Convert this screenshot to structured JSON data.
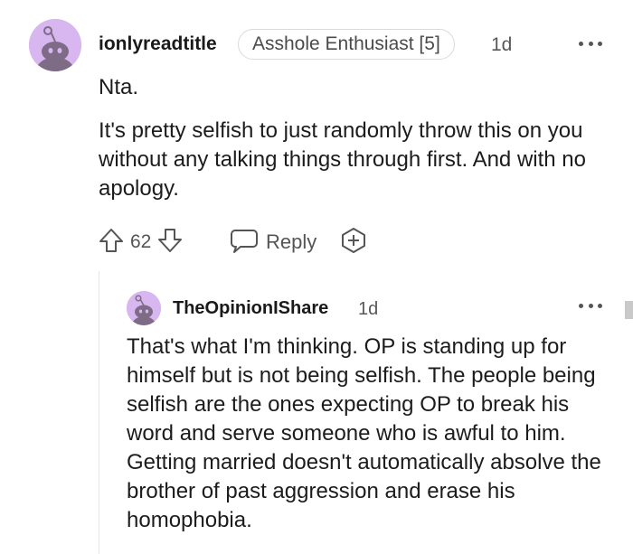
{
  "comment": {
    "username": "ionlyreadtitle",
    "flair": "Asshole Enthusiast [5]",
    "time": "1d",
    "paragraphs": [
      "Nta.",
      "It's pretty selfish to just randomly throw this on you without any talking things through first. And with no apology."
    ],
    "score": "62",
    "reply_label": "Reply",
    "colors": {
      "avatar_bg": "#d8b6f0",
      "avatar_figure": "#7e6b86"
    },
    "icons": [
      "snoo-avatar-icon",
      "upvote-icon",
      "downvote-icon",
      "reply-icon",
      "award-icon",
      "more-options-icon"
    ]
  },
  "reply": {
    "username": "TheOpinionIShare",
    "time": "1d",
    "text": "That's what I'm thinking. OP is standing up for himself but is not being selfish. The people being selfish are the ones expecting OP to break his word and serve someone who is awful to him. Getting married doesn't automatically absolve the brother of past aggression and erase his homophobia.",
    "colors": {
      "avatar_bg": "#d8b6f0",
      "avatar_figure": "#7e6b86"
    },
    "icons": [
      "snoo-avatar-icon",
      "more-options-icon"
    ]
  }
}
